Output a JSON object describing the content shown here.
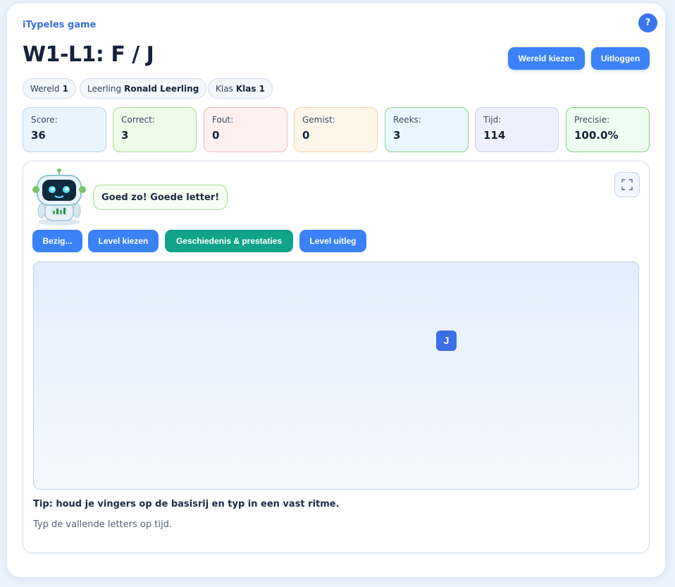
{
  "header": {
    "brand": "iTypeles game",
    "help_label": "?",
    "title": "W1-L1: F / J",
    "world_button": "Wereld kiezen",
    "logout_button": "Uitloggen"
  },
  "info": {
    "world_label": "Wereld",
    "world_value": "1",
    "student_label": "Leerling",
    "student_value": "Ronald Leerling",
    "class_label": "Klas",
    "class_value": "Klas 1"
  },
  "stats": [
    {
      "label": "Score:",
      "value": "36"
    },
    {
      "label": "Correct:",
      "value": "3"
    },
    {
      "label": "Fout:",
      "value": "0"
    },
    {
      "label": "Gemist:",
      "value": "0"
    },
    {
      "label": "Reeks:",
      "value": "3"
    },
    {
      "label": "Tijd:",
      "value": "114"
    },
    {
      "label": "Precisie:",
      "value": "100.0%"
    }
  ],
  "game": {
    "speech": "Goed zo! Goede letter!",
    "buttons": {
      "status": "Bezig...",
      "level_select": "Level kiezen",
      "history": "Geschiedenis & prestaties",
      "level_info": "Level uitleg"
    },
    "falling_letter": "J",
    "tip": "Tip: houd je vingers op de basisrij en typ in een vast ritme.",
    "instruction": "Typ de vallende letters op tijd."
  },
  "colors": {
    "primary": "#3b82f6",
    "teal": "#10a38a",
    "title": "#15223a",
    "brand": "#3a6fd8"
  },
  "icons": {
    "help": "question-icon",
    "fullscreen": "fullscreen-icon",
    "mascot": "robot-mascot-icon"
  }
}
